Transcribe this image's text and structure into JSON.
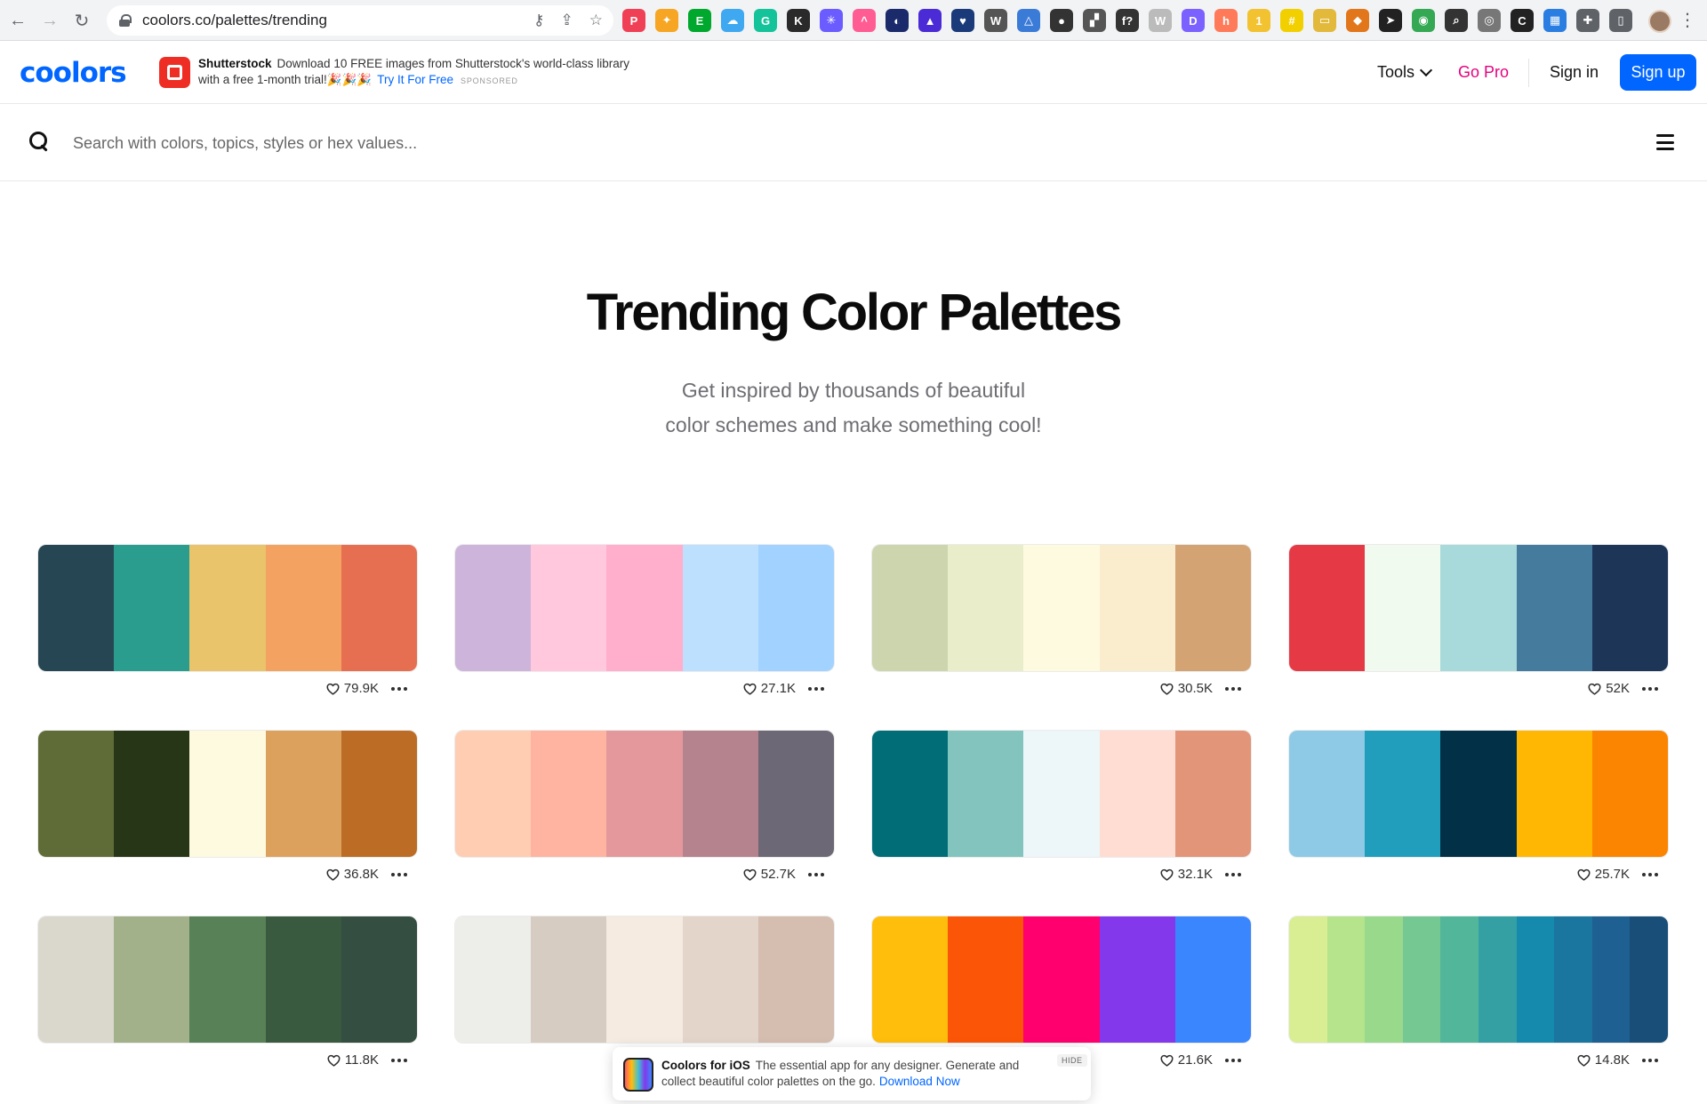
{
  "browser": {
    "url": "coolors.co/palettes/trending",
    "back_label": "←",
    "forward_label": "→",
    "reload_label": "↻",
    "extensions": [
      {
        "name": "pocket-icon",
        "glyph": "P",
        "color": "#ef4056"
      },
      {
        "name": "dropbox-icon",
        "glyph": "✦",
        "color": "#f6a623"
      },
      {
        "name": "evernote-icon",
        "glyph": "E",
        "color": "#00a82d"
      },
      {
        "name": "cloud-icon",
        "glyph": "☁",
        "color": "#3ea8f1"
      },
      {
        "name": "grammarly-icon",
        "glyph": "G",
        "color": "#15c39a"
      },
      {
        "name": "k-icon",
        "glyph": "K",
        "color": "#2a2a2a"
      },
      {
        "name": "asterisk-icon",
        "glyph": "✳",
        "color": "#6b5cff"
      },
      {
        "name": "clickup-icon",
        "glyph": "^",
        "color": "#ff5c93"
      },
      {
        "name": "half-moon-icon",
        "glyph": "◐",
        "color": "#1b2a6b"
      },
      {
        "name": "grad-cap-icon",
        "glyph": "▲",
        "color": "#4b2bd6"
      },
      {
        "name": "heart-shield-icon",
        "glyph": "♥",
        "color": "#1a3a7a"
      },
      {
        "name": "wordpress-icon",
        "glyph": "W",
        "color": "#555555"
      },
      {
        "name": "triangle-icon",
        "glyph": "△",
        "color": "#3b7bd8"
      },
      {
        "name": "penguin-icon",
        "glyph": "●",
        "color": "#333333"
      },
      {
        "name": "stairs-icon",
        "glyph": "▞",
        "color": "#555555"
      },
      {
        "name": "fx-icon",
        "glyph": "f?",
        "color": "#333333"
      },
      {
        "name": "w-box-icon",
        "glyph": "W",
        "color": "#bbbbbb"
      },
      {
        "name": "d-icon",
        "glyph": "D",
        "color": "#7b61ff"
      },
      {
        "name": "hubspot-icon",
        "glyph": "h",
        "color": "#ff7a59"
      },
      {
        "name": "badge-icon",
        "glyph": "1",
        "color": "#f2c230"
      },
      {
        "name": "hash-icon",
        "glyph": "#",
        "color": "#f2d000"
      },
      {
        "name": "folder-icon",
        "glyph": "▭",
        "color": "#e2b93b"
      },
      {
        "name": "metamask-icon",
        "glyph": "◆",
        "color": "#e2761b"
      },
      {
        "name": "send-icon",
        "glyph": "➤",
        "color": "#222222"
      },
      {
        "name": "chrome-ext-icon",
        "glyph": "◉",
        "color": "#34a853"
      },
      {
        "name": "screen-search-icon",
        "glyph": "⌕",
        "color": "#333333"
      },
      {
        "name": "camera-icon",
        "glyph": "◎",
        "color": "#777777"
      },
      {
        "name": "c-circle-icon",
        "glyph": "C",
        "color": "#222222"
      },
      {
        "name": "layout-icon",
        "glyph": "▦",
        "color": "#2a7de1"
      },
      {
        "name": "puzzle-icon",
        "glyph": "✚",
        "color": "#5f6368"
      },
      {
        "name": "sidepanel-icon",
        "glyph": "▯",
        "color": "#5f6368"
      }
    ]
  },
  "header": {
    "logo": "coolors",
    "ad": {
      "brand": "Shutterstock",
      "text": "Download 10 FREE images from Shutterstock's world-class library with a free 1-month trial!🎉🎉🎉",
      "link": "Try It For Free",
      "sponsored": "SPONSORED"
    },
    "tools_label": "Tools",
    "gopro_label": "Go Pro",
    "signin_label": "Sign in",
    "signup_label": "Sign up"
  },
  "search": {
    "placeholder": "Search with colors, topics, styles or hex values..."
  },
  "hero": {
    "title": "Trending Color Palettes",
    "subtitle_line1": "Get inspired by thousands of beautiful",
    "subtitle_line2": "color schemes and make something cool!"
  },
  "palettes": [
    {
      "colors": [
        "#264653",
        "#2a9d8f",
        "#e9c46a",
        "#f4a261",
        "#e76f51"
      ],
      "likes": "79.9K"
    },
    {
      "colors": [
        "#cdb4db",
        "#ffc8dd",
        "#ffafcc",
        "#bde0fe",
        "#a2d2ff"
      ],
      "likes": "27.1K"
    },
    {
      "colors": [
        "#ccd5ae",
        "#e9edc9",
        "#fefae0",
        "#faedcd",
        "#d4a373"
      ],
      "likes": "30.5K"
    },
    {
      "colors": [
        "#e63946",
        "#f1faee",
        "#a8dadc",
        "#457b9d",
        "#1d3557"
      ],
      "likes": "52K"
    },
    {
      "colors": [
        "#606c38",
        "#283618",
        "#fefae0",
        "#dda15e",
        "#bc6c25"
      ],
      "likes": "36.8K"
    },
    {
      "colors": [
        "#ffcdb2",
        "#ffb4a2",
        "#e5989b",
        "#b5838d",
        "#6d6875"
      ],
      "likes": "52.7K"
    },
    {
      "colors": [
        "#006d77",
        "#83c5be",
        "#edf6f9",
        "#ffddd2",
        "#e29578"
      ],
      "likes": "32.1K"
    },
    {
      "colors": [
        "#8ecae6",
        "#219ebc",
        "#023047",
        "#ffb703",
        "#fb8500"
      ],
      "likes": "25.7K"
    },
    {
      "colors": [
        "#dad7cd",
        "#a3b18a",
        "#588157",
        "#3a5a40",
        "#344e41"
      ],
      "likes": "11.8K"
    },
    {
      "colors": [
        "#edede9",
        "#d6ccc2",
        "#f5ebe0",
        "#e3d5ca",
        "#d5bdaf"
      ],
      "likes": ""
    },
    {
      "colors": [
        "#ffbe0b",
        "#fb5607",
        "#ff006e",
        "#8338ec",
        "#3a86ff"
      ],
      "likes": "21.6K"
    },
    {
      "colors": [
        "#d9ed92",
        "#b5e48c",
        "#99d98c",
        "#76c893",
        "#52b69a",
        "#34a0a4",
        "#168aad",
        "#1a759f",
        "#1e6091",
        "#184e77"
      ],
      "likes": "14.8K"
    }
  ],
  "ios_popup": {
    "title": "Coolors for iOS",
    "text": "The essential app for any designer. Generate and collect beautiful color palettes on the go.",
    "link": "Download Now",
    "hide": "HIDE"
  }
}
